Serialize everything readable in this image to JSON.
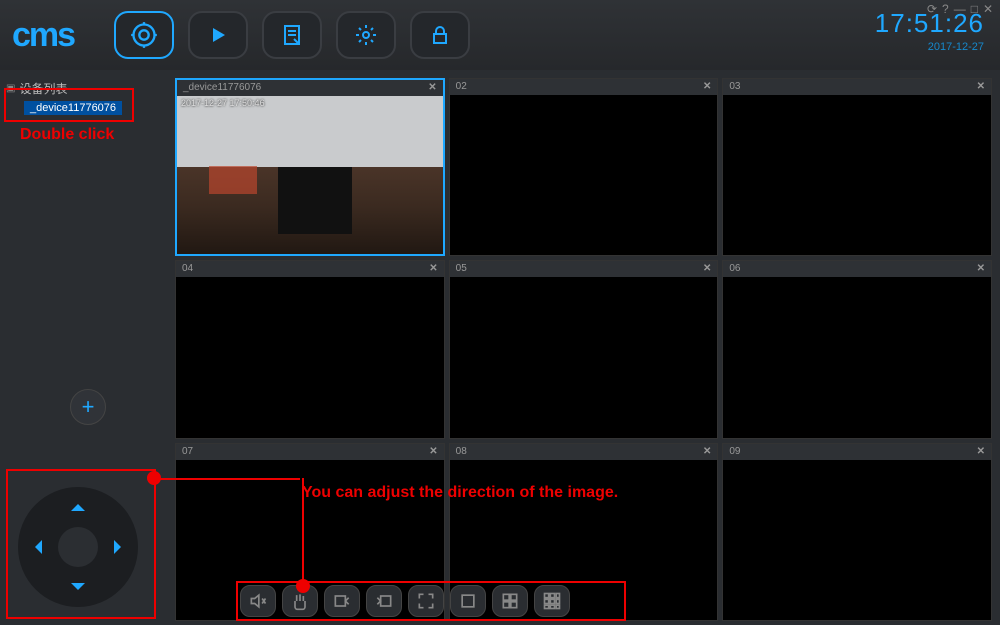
{
  "header": {
    "logo": "cms",
    "time": "17:51:26",
    "date": "2017-12-27",
    "win_controls": [
      "⟳",
      "?",
      "—",
      "□",
      "✕"
    ]
  },
  "sidebar": {
    "root_label": "设备列表",
    "device_label": "_device11776076",
    "add_label": "+"
  },
  "annotations": {
    "double_click": "Double click",
    "direction_hint": "You can adjust the direction of the image."
  },
  "grid": {
    "cells": [
      {
        "label": "_device11776076",
        "overlay": "2017-12-27  17:50:46",
        "active": true,
        "has_video": true
      },
      {
        "label": "02"
      },
      {
        "label": "03"
      },
      {
        "label": "04"
      },
      {
        "label": "05"
      },
      {
        "label": "06"
      },
      {
        "label": "07"
      },
      {
        "label": "08"
      },
      {
        "label": "09"
      }
    ],
    "close_glyph": "✕"
  }
}
